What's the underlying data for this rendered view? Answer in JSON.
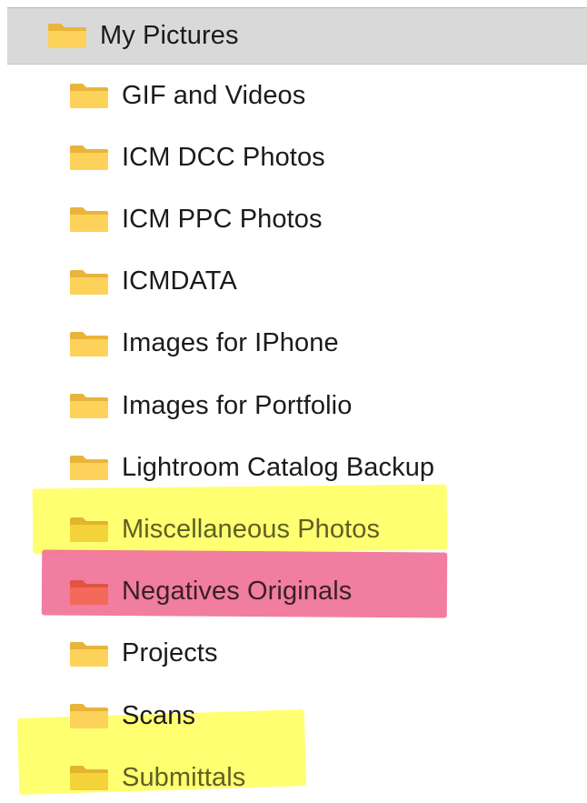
{
  "tree": {
    "root": {
      "label": "My Pictures",
      "icon": "folder-icon"
    },
    "children": [
      {
        "label": "GIF and Videos",
        "icon": "folder-icon"
      },
      {
        "label": "ICM DCC Photos",
        "icon": "folder-icon"
      },
      {
        "label": "ICM PPC Photos",
        "icon": "folder-icon"
      },
      {
        "label": "ICMDATA",
        "icon": "folder-icon"
      },
      {
        "label": "Images for IPhone",
        "icon": "folder-icon"
      },
      {
        "label": "Images for Portfolio",
        "icon": "folder-icon"
      },
      {
        "label": "Lightroom Catalog Backup",
        "icon": "folder-icon"
      },
      {
        "label": "Miscellaneous Photos",
        "icon": "folder-icon",
        "highlight": "yellow"
      },
      {
        "label": "Negatives Originals",
        "icon": "folder-icon",
        "highlight": "pink"
      },
      {
        "label": "Projects",
        "icon": "folder-icon"
      },
      {
        "label": "Scans",
        "icon": "folder-icon"
      },
      {
        "label": "Submittals",
        "icon": "folder-icon",
        "highlight": "yellow"
      }
    ]
  },
  "colors": {
    "selected_row": "#d9d9d9",
    "folder": "#f7c948",
    "highlight_yellow": "#ffff66",
    "highlight_pink": "#f06f97"
  }
}
